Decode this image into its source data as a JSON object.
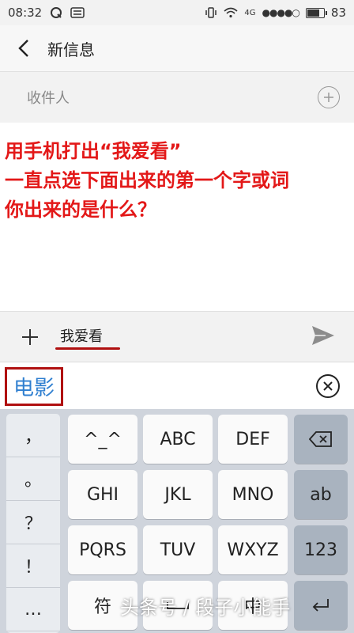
{
  "status_bar": {
    "time": "08:32",
    "network": "4G",
    "signal_dots": "●●●●○",
    "battery": "83",
    "battery_level": 0.83
  },
  "header": {
    "title": "新信息"
  },
  "recipient": {
    "placeholder": "收件人"
  },
  "overlay_text": [
    "用手机打出“我爱看”",
    "一直点选下面出来的第一个字或词",
    "你出来的是什么？"
  ],
  "compose": {
    "text": "我爱看"
  },
  "candidate": {
    "word": "电影"
  },
  "keyboard": {
    "punctuation": [
      "，",
      "。",
      "？",
      "！",
      "…"
    ],
    "keys": {
      "emoticon": "^_^",
      "abc": "ABC",
      "def": "DEF",
      "ghi": "GHI",
      "jkl": "JKL",
      "mno": "MNO",
      "pqrs": "PQRS",
      "tuv": "TUV",
      "wxyz": "WXYZ",
      "en": "ab",
      "num": "123",
      "symbol": "符",
      "zh": "中"
    }
  },
  "watermark": "头条号 / 段子小能手",
  "colors": {
    "accent_red": "#e31818",
    "underline_red": "#b01010",
    "candidate_blue": "#2f7fd0"
  }
}
